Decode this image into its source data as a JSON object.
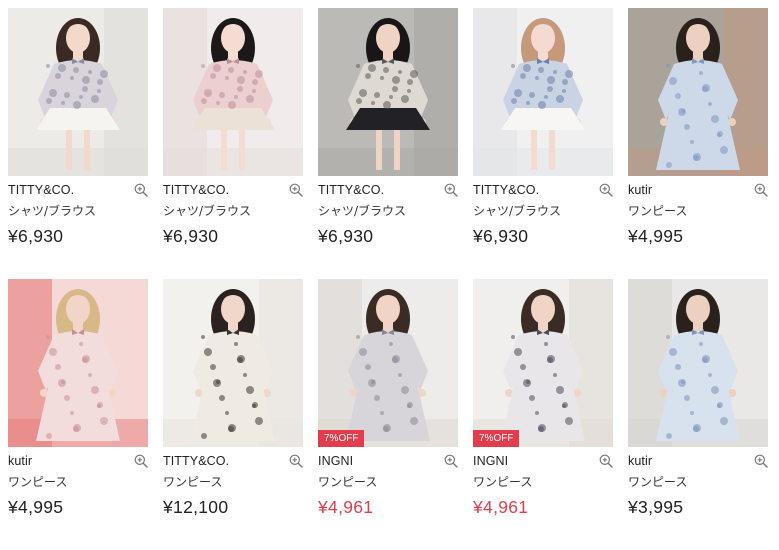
{
  "products": [
    {
      "brand": "TITTY&CO.",
      "category": "シャツ/ブラウス",
      "price": "¥6,930",
      "sale": false,
      "badge": "",
      "palette": {
        "bg": "#ecebe8",
        "bg2": "#dedcd8",
        "hair": "#3b2a24",
        "skin": "#f2d9cc",
        "top": "#d9d4dc",
        "pattern": "#8b8aa0",
        "bottom": "#f6f4f1"
      }
    },
    {
      "brand": "TITTY&CO.",
      "category": "シャツ/ブラウス",
      "price": "¥6,930",
      "sale": false,
      "badge": "",
      "palette": {
        "bg": "#f1eceb",
        "bg2": "#e4dcd9",
        "hair": "#1c1718",
        "skin": "#f4dcd2",
        "top": "#eccfcf",
        "pattern": "#b98f97",
        "bottom": "#ece1d6"
      }
    },
    {
      "brand": "TITTY&CO.",
      "category": "シャツ/ブラウス",
      "price": "¥6,930",
      "sale": false,
      "badge": "",
      "palette": {
        "bg": "#bcbab6",
        "bg2": "#a9a7a3",
        "hair": "#1a1516",
        "skin": "#efd3c5",
        "top": "#dedad3",
        "pattern": "#5b5a58",
        "bottom": "#222226"
      }
    },
    {
      "brand": "TITTY&CO.",
      "category": "シャツ/ブラウス",
      "price": "¥6,930",
      "sale": false,
      "badge": "",
      "palette": {
        "bg": "#f0f0f1",
        "bg2": "#e2e3e6",
        "hair": "#c49a7a",
        "skin": "#f4dad0",
        "top": "#c9d3e4",
        "pattern": "#6c7fa8",
        "bottom": "#f7f6f4"
      }
    },
    {
      "brand": "kutir",
      "category": "ワンピース",
      "price": "¥4,995",
      "sale": false,
      "badge": "",
      "palette": {
        "bg": "#a9a39a",
        "bg2": "#c29a84",
        "hair": "#2a211c",
        "skin": "#ecd0c0",
        "top": "#cdd8e8",
        "pattern": "#7f98bf",
        "bottom": "#cdd8e8"
      }
    },
    {
      "brand": "kutir",
      "category": "ワンピース",
      "price": "¥4,995",
      "sale": false,
      "badge": "",
      "palette": {
        "bg": "#f4d9d6",
        "bg2": "#e67c7a",
        "hair": "#d8b886",
        "skin": "#f2d4c8",
        "top": "#f3dcdc",
        "pattern": "#c98f93",
        "bottom": "#f3dcdc"
      }
    },
    {
      "brand": "TITTY&CO.",
      "category": "ワンピース",
      "price": "¥12,100",
      "sale": false,
      "badge": "",
      "palette": {
        "bg": "#f3f1ee",
        "bg2": "#e7e3dd",
        "hair": "#2b2120",
        "skin": "#f1d6ca",
        "top": "#f0ebe2",
        "pattern": "#3a3532",
        "bottom": "#f0ebe2"
      }
    },
    {
      "brand": "INGNI",
      "category": "ワンピース",
      "price": "¥4,961",
      "sale": true,
      "badge": "7%OFF",
      "palette": {
        "bg": "#eeeceb",
        "bg2": "#dcd7d2",
        "hair": "#3a2c25",
        "skin": "#f0d5c7",
        "top": "#d7d4da",
        "pattern": "#8a8696",
        "bottom": "#d7d4da"
      }
    },
    {
      "brand": "INGNI",
      "category": "ワンピース",
      "price": "¥4,961",
      "sale": true,
      "badge": "7%OFF",
      "palette": {
        "bg": "#f1efed",
        "bg2": "#e1dbd6",
        "hair": "#3a2c25",
        "skin": "#f0d5c7",
        "top": "#e9e6ea",
        "pattern": "#4d4b5a",
        "bottom": "#e9e6ea"
      }
    },
    {
      "brand": "kutir",
      "category": "ワンピース",
      "price": "¥3,995",
      "sale": false,
      "badge": "",
      "palette": {
        "bg": "#e9e8e6",
        "bg2": "#d5d3cf",
        "hair": "#2a211c",
        "skin": "#ecd0c0",
        "top": "#d8e1ee",
        "pattern": "#7e93b8",
        "bottom": "#d8e1ee"
      }
    }
  ],
  "icons": {
    "zoom": "zoom-in-icon"
  }
}
